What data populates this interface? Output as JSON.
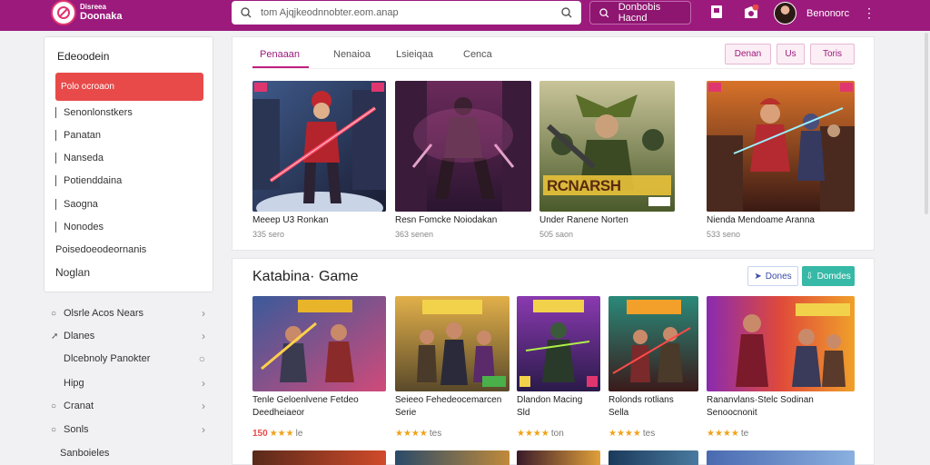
{
  "header": {
    "brand_line1": "Disreea",
    "brand_line2": "Doonaka",
    "search_text": "tom Ajqjkeodnnobter.eom.anap",
    "action_button": "Donbobis Hacnd",
    "notification_count": "1",
    "user_name": "Benonorc"
  },
  "sidebar": {
    "title": "Edeoodein",
    "items": [
      {
        "label": "Polo ocroaon"
      },
      {
        "label": "Senonlonstkers"
      },
      {
        "label": "Panatan"
      },
      {
        "label": "Nanseda"
      },
      {
        "label": "Potienddaina"
      },
      {
        "label": "Saogna"
      },
      {
        "label": "Nonodes"
      },
      {
        "label": "Poisedoeodeornanis"
      },
      {
        "label": "Noglan"
      }
    ],
    "list": [
      {
        "label": "Olsrle Acos Nears"
      },
      {
        "label": "Dlanes"
      },
      {
        "label": "Dlcebnoly Panokter"
      },
      {
        "label": "Hipg"
      },
      {
        "label": "Cranat"
      },
      {
        "label": "Sonls"
      },
      {
        "label": "Sanboieles"
      }
    ]
  },
  "panel1": {
    "tabs": [
      "Penaaan",
      "Nenaioa",
      "Lsieiqaa",
      "Cenca"
    ],
    "buttons": [
      "Denan",
      "Us",
      "Toris"
    ],
    "cards": [
      {
        "title": "Meeep U3 Ronkan",
        "meta": "335 sero",
        "badge": "rna"
      },
      {
        "title": "Resn Fomcke Noiodakan",
        "meta": "363 senen"
      },
      {
        "title": "Under Ranene Norten",
        "meta": "505 saon",
        "logo": "RCNARSH"
      },
      {
        "title": "Nienda Mendoame Aranna",
        "meta": "533 seno"
      }
    ]
  },
  "panel2": {
    "title": "Katabina· Game",
    "button1": "Dones",
    "button2": "Domdes",
    "cards": [
      {
        "title_l1": "Tenle Geloenlvene Fetdeo",
        "title_l2": "Deedheiaeor",
        "rating_num": "150",
        "stars": "★★★",
        "suffix": "le"
      },
      {
        "title_l1": "Seieeo Fehedeocemarcen",
        "title_l2": "Serie",
        "stars": "★★★★",
        "suffix": "tes"
      },
      {
        "title_l1": "Dlandon Macing",
        "title_l2": "Sld",
        "stars": "★★★★",
        "suffix": "ton"
      },
      {
        "title_l1": "Rolonds rotlians",
        "title_l2": "Sella",
        "stars": "★★★★",
        "suffix": "tes"
      },
      {
        "title_l1": "Rananvlans·Stelc Sodinan",
        "title_l2": "Senoocnonit",
        "stars": "★★★★",
        "suffix": "te"
      }
    ]
  },
  "colors": {
    "header": "#9c1a7c",
    "active_sidebar": "#e84a4a",
    "teal_button": "#36b9a6",
    "star": "#f0a21b"
  }
}
